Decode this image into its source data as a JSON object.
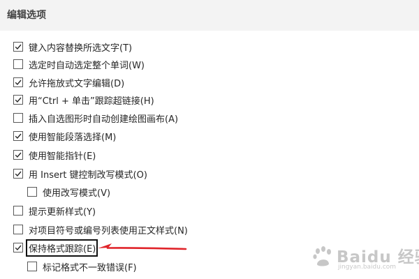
{
  "section": {
    "title": "编辑选项"
  },
  "options": [
    {
      "label": "键入内容替换所选文字(T)",
      "checked": true
    },
    {
      "label": "选定时自动选定整个单词(W)",
      "checked": false
    },
    {
      "label": "允许拖放式文字编辑(D)",
      "checked": true
    },
    {
      "label": "用“Ctrl + 单击”跟踪超链接(H)",
      "checked": true
    },
    {
      "label": "插入自选图形时自动创建绘图画布(A)",
      "checked": false
    },
    {
      "label": "使用智能段落选择(M)",
      "checked": true
    },
    {
      "label": "使用智能指针(E)",
      "checked": true
    },
    {
      "label": "用 Insert 键控制改写模式(O)",
      "checked": true
    },
    {
      "label": "使用改写模式(V)",
      "checked": false
    },
    {
      "label": "提示更新样式(Y)",
      "checked": false
    },
    {
      "label": "对项目符号或编号列表使用正文样式(N)",
      "checked": false
    },
    {
      "label": "保持格式跟踪(E)",
      "checked": true
    },
    {
      "label": "标记格式不一致错误(F)",
      "checked": false
    }
  ],
  "annotation": {
    "color": "#e0242a",
    "icon": "red-arrow-icon"
  },
  "watermark": {
    "text": "Baidu 经验",
    "subtext": "jingyan.baidu.com"
  }
}
